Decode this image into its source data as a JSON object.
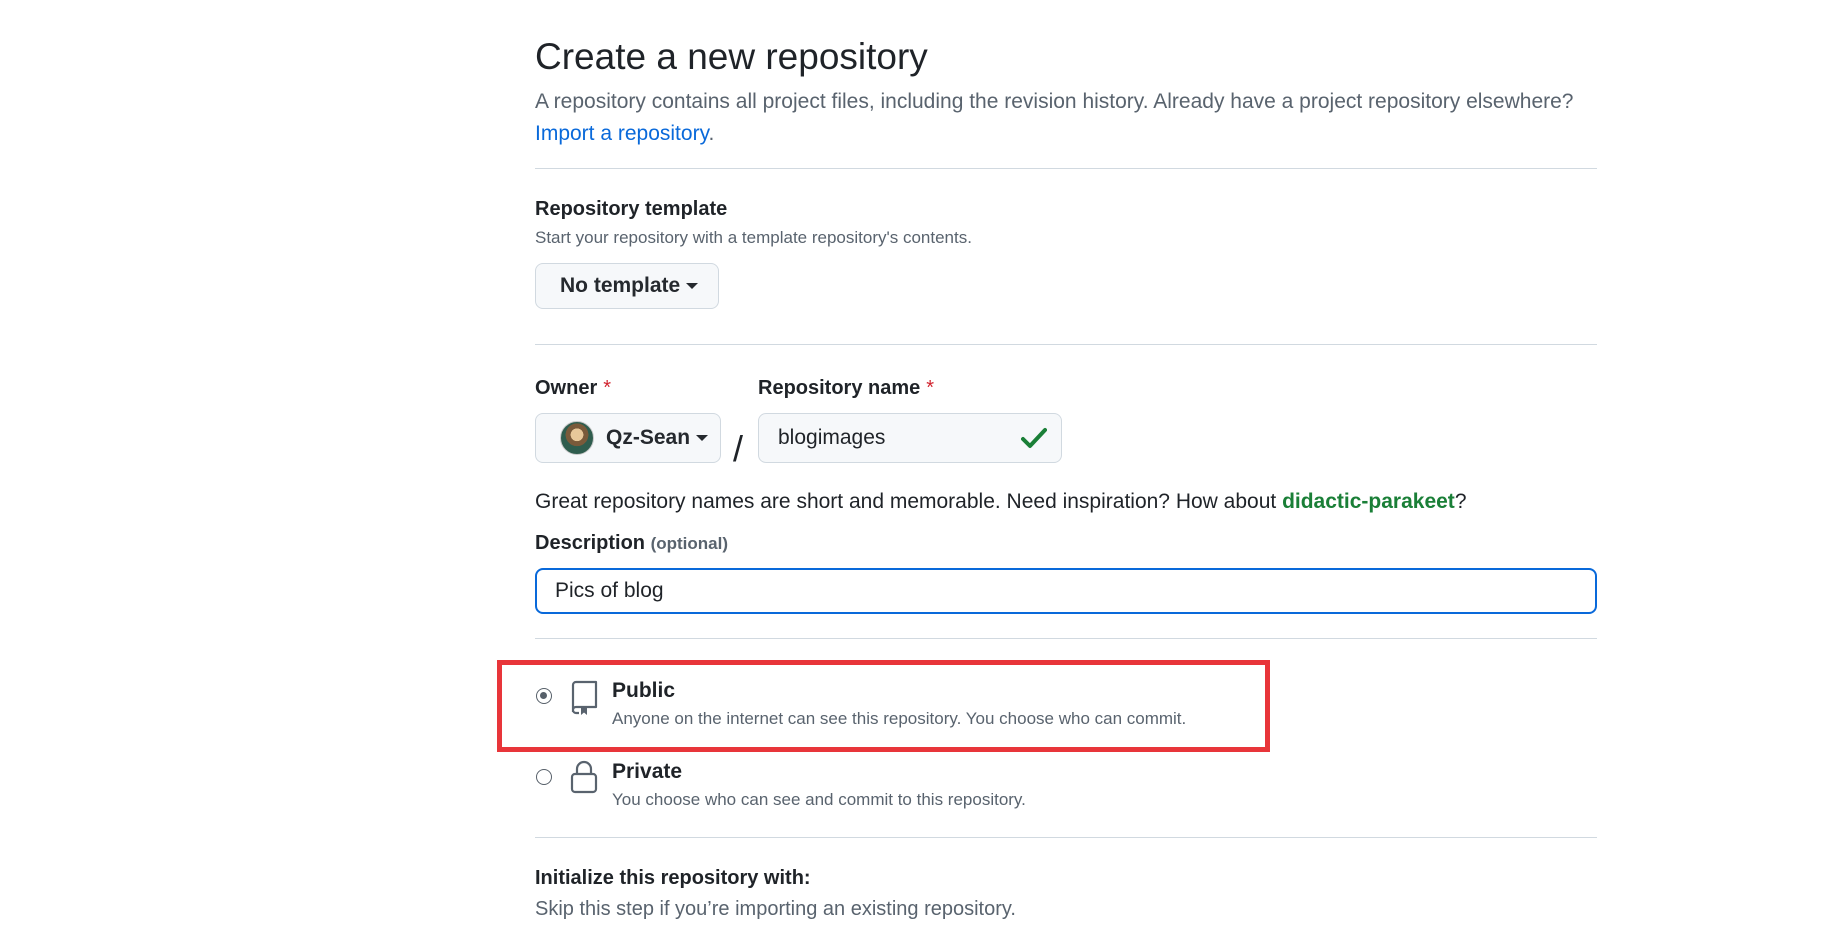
{
  "header": {
    "title": "Create a new repository",
    "subtitle": "A repository contains all project files, including the revision history. Already have a project repository elsewhere?",
    "import_link": "Import a repository",
    "import_suffix": "."
  },
  "template": {
    "label": "Repository template",
    "note": "Start your repository with a template repository's contents.",
    "button_label": "No template"
  },
  "owner": {
    "label": "Owner",
    "required_mark": "*",
    "value": "Qz-Sean",
    "avatar_icon": "avatar-image"
  },
  "repo_name": {
    "label": "Repository name",
    "required_mark": "*",
    "value": "blogimages",
    "valid_icon": "check-icon",
    "separator": "/"
  },
  "name_hint": {
    "prefix": "Great repository names are short and memorable. Need inspiration? How about ",
    "suggestion": "didactic-parakeet",
    "suffix": "?"
  },
  "description": {
    "label": "Description",
    "optional": "(optional)",
    "value": "Pics of blog"
  },
  "visibility": {
    "options": [
      {
        "title": "Public",
        "desc": "Anyone on the internet can see this repository. You choose who can commit.",
        "checked": true,
        "icon": "repo-icon"
      },
      {
        "title": "Private",
        "desc": "You choose who can see and commit to this repository.",
        "checked": false,
        "icon": "lock-icon"
      }
    ],
    "highlight_color": "#e8353a"
  },
  "initialize": {
    "label": "Initialize this repository with:",
    "note": "Skip this step if you’re importing an existing repository."
  },
  "colors": {
    "link": "#0969da",
    "suggestion": "#1a7f37",
    "required": "#d1242f",
    "focus": "#0969da"
  }
}
